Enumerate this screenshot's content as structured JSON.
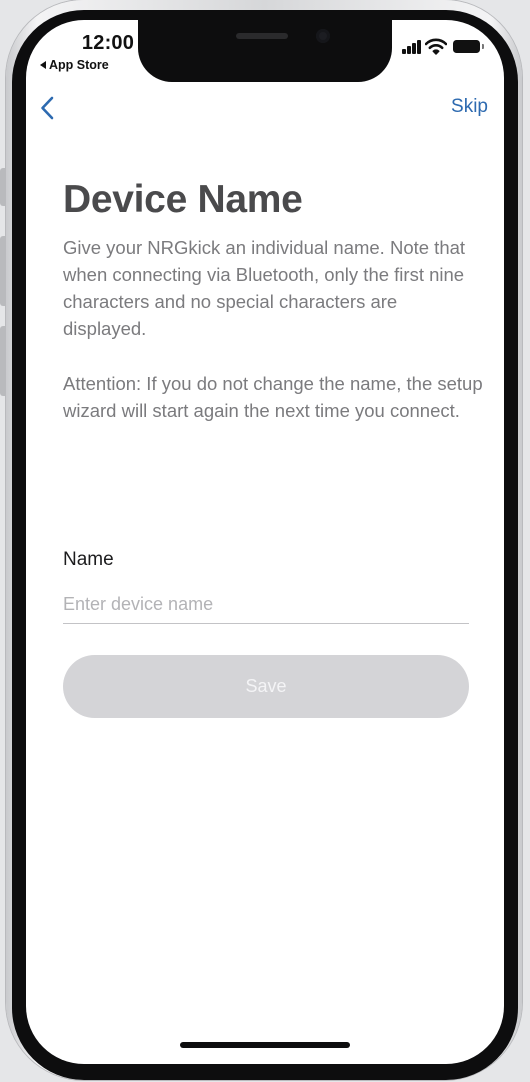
{
  "status_bar": {
    "time": "12:00",
    "back_app": "App Store",
    "icons": [
      "signal-icon",
      "wifi-icon",
      "battery-icon"
    ]
  },
  "nav": {
    "back_icon": "chevron-left-icon",
    "skip_label": "Skip"
  },
  "page": {
    "title": "Device Name",
    "description": "Give your NRGkick an individual name. Note that when connecting via Bluetooth, only the first nine characters and no special characters are displayed.",
    "attention": "Attention: If you do not change the name, the setup wizard will start again the next time you connect."
  },
  "form": {
    "name_label": "Name",
    "name_value": "",
    "name_placeholder": "Enter device name",
    "save_label": "Save",
    "save_enabled": false
  },
  "colors": {
    "accent": "#2d6ab0",
    "title": "#4a4a4c",
    "body_text": "#7b7b7e",
    "disabled_button": "#d4d4d7"
  }
}
